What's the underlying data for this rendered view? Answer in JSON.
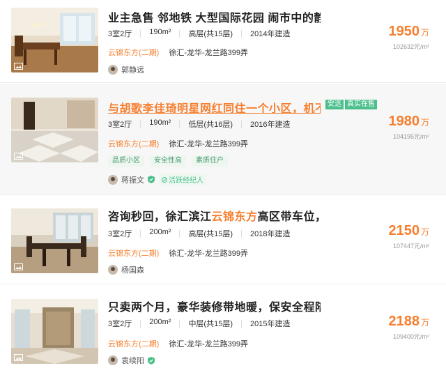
{
  "listings": [
    {
      "title": "业主急售 邻地铁 大型国际花园 闹市中的静谧...",
      "layout": "3室2厅",
      "area": "190m²",
      "floor": "高层(共15层)",
      "year": "2014年建造",
      "community": "云锦东方(二期)",
      "address": "徐汇-龙华-龙兰路399弄",
      "agent": "郭静远",
      "price": "1950",
      "price_unit": "万",
      "unit_price": "102632元/m²"
    },
    {
      "title": "与胡歌李佳琦明星网红同住一个小区，机不可...",
      "badges": [
        "安选",
        "真实在售"
      ],
      "layout": "3室2厅",
      "area": "190m²",
      "floor": "低层(共16层)",
      "year": "2016年建造",
      "community": "云锦东方(二期)",
      "address": "徐汇-龙华-龙兰路399弄",
      "tags": [
        "品质小区",
        "安全性高",
        "素质住户"
      ],
      "agent": "蒋振文",
      "agent_badge": "活跃经纪人",
      "price": "1980",
      "price_unit": "万",
      "unit_price": "104195元/m²"
    },
    {
      "title_pre": "咨询秒回，徐汇滨江",
      "title_hl": "云锦东方",
      "title_post": "高区带车位，诚...",
      "layout": "3室2厅",
      "area": "200m²",
      "floor": "高层(共15层)",
      "year": "2018年建造",
      "community": "云锦东方(二期)",
      "address": "徐汇-龙华-龙兰路399弄",
      "agent": "杨国森",
      "price": "2150",
      "price_unit": "万",
      "unit_price": "107447元/m²"
    },
    {
      "title": "只卖两个月，豪华装修带地暖，保安全程陪同...",
      "layout": "3室2厅",
      "area": "200m²",
      "floor": "中层(共15层)",
      "year": "2015年建造",
      "community": "云锦东方(二期)",
      "address": "徐汇-龙华-龙兰路399弄",
      "agent": "袁续阳",
      "price": "2188",
      "price_unit": "万",
      "unit_price": "109400元/m²"
    }
  ],
  "colors": {
    "accent": "#f77f2f",
    "badge_green": "#4bbf8c",
    "tag_green": "#4a9a72"
  }
}
